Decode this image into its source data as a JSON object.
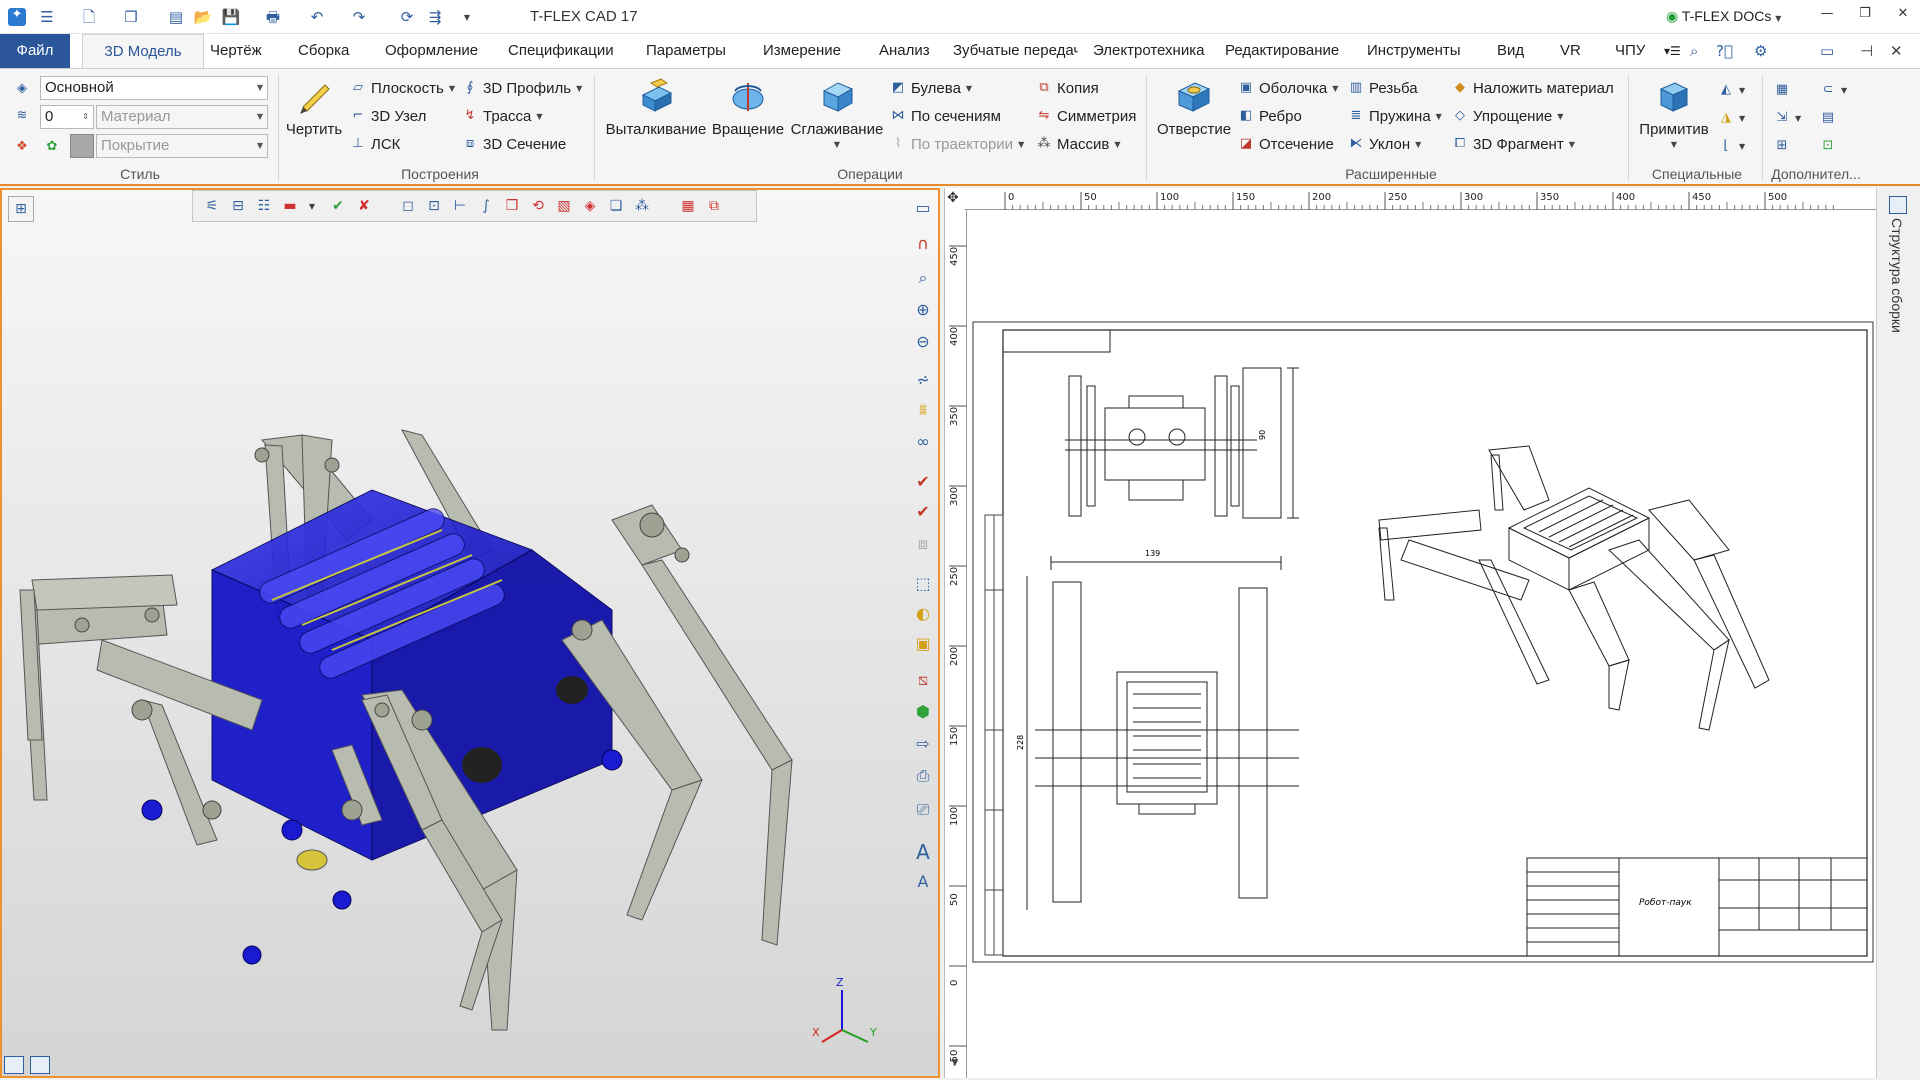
{
  "app": {
    "title": "T-FLEX CAD 17",
    "docs_button": "T-FLEX DOCs",
    "window_controls": [
      "minimize-icon",
      "restore-icon",
      "close-icon"
    ]
  },
  "menu_tabs": [
    "Файл",
    "3D Модель",
    "Чертёж",
    "Сборка",
    "Оформление",
    "Спецификации",
    "Параметры",
    "Измерение",
    "Анализ",
    "Зубчатые передачи",
    "Электротехника",
    "Редактирование",
    "Инструменты",
    "Вид",
    "VR",
    "ЧПУ"
  ],
  "ribbon": {
    "style": {
      "label": "Стиль",
      "layer": "Основной",
      "priority": "0",
      "material_placeholder": "Материал",
      "coating_placeholder": "Покрытие"
    },
    "build": {
      "label": "Построения",
      "draw": "Чертить",
      "items": [
        "Плоскость",
        "3D Узел",
        "ЛСК",
        "3D Профиль",
        "Трасса",
        "3D Сечение"
      ]
    },
    "operations": {
      "label": "Операции",
      "big": [
        "Выталкивание",
        "Вращение",
        "Сглаживание"
      ],
      "items": [
        "Булева",
        "По сечениям",
        "По траектории",
        "Копия",
        "Симметрия",
        "Массив"
      ]
    },
    "extended": {
      "label": "Расширенные",
      "hole": "Отверстие",
      "items": [
        "Оболочка",
        "Ребро",
        "Отсечение",
        "Резьба",
        "Пружина",
        "Уклон",
        "Наложить материал",
        "Упрощение",
        "3D Фрагмент"
      ]
    },
    "special": {
      "label": "Специальные",
      "primitive": "Примитив"
    },
    "extra": {
      "label": "Дополнител..."
    }
  },
  "ruler": {
    "top": [
      "0",
      "50",
      "100",
      "150",
      "200",
      "250",
      "300",
      "350",
      "400",
      "450",
      "500"
    ],
    "left": [
      "450",
      "400",
      "350",
      "300",
      "250",
      "200",
      "150",
      "100",
      "50",
      "0",
      "-50"
    ]
  },
  "drawing": {
    "dim_width": "139",
    "dim_height": "228",
    "dim_top_height": "90",
    "title_block_name": "Робот-паук"
  },
  "sidebar": {
    "panel_title": "Структура сборки"
  },
  "axes": {
    "x": "X",
    "y": "Y",
    "z": "Z"
  },
  "colors": {
    "accent": "#2b579a",
    "active_border": "#f0922b",
    "body_blue": "#1a1ad6",
    "leg_gray": "#b8bcb0"
  }
}
